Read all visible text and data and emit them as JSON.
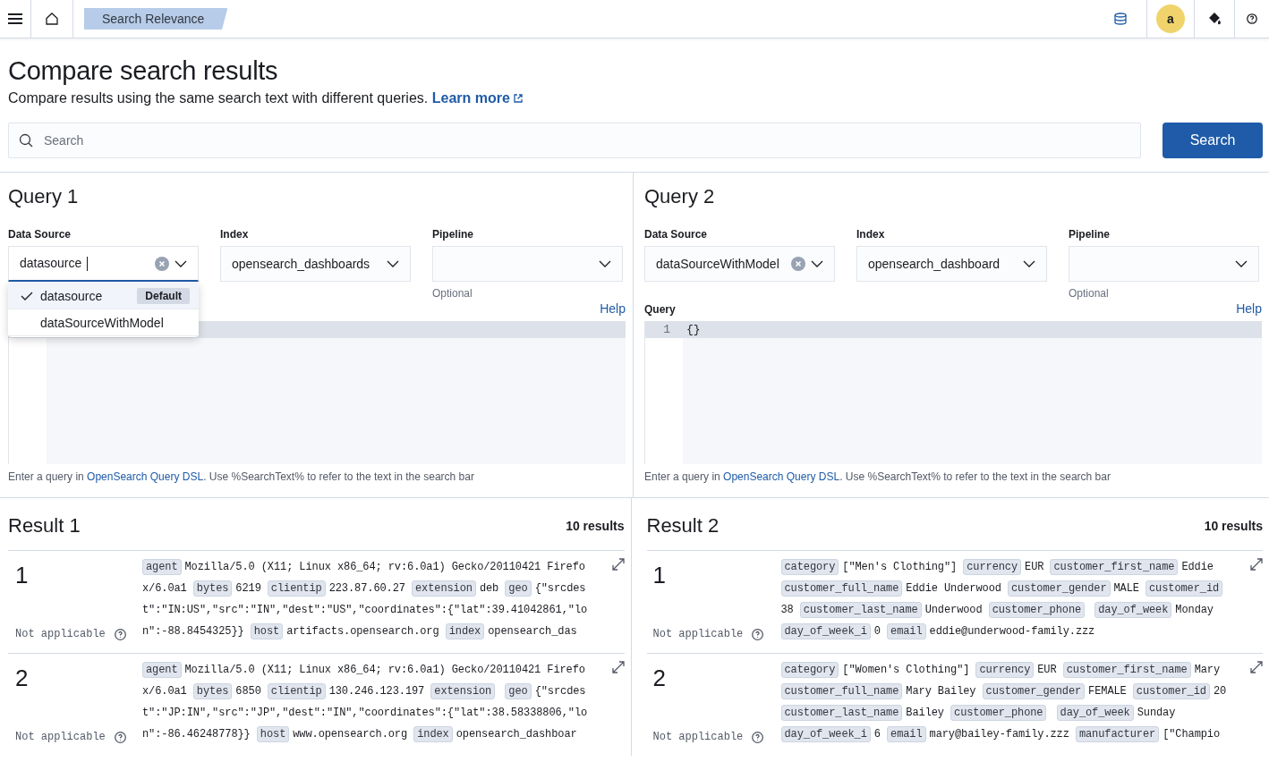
{
  "header": {
    "breadcrumb": "Search Relevance",
    "avatar": "a"
  },
  "page": {
    "title": "Compare search results",
    "description": "Compare results using the same search text with different queries. ",
    "learn_more": "Learn more"
  },
  "search": {
    "placeholder": "Search",
    "button": "Search"
  },
  "queries": [
    {
      "title": "Query 1",
      "data_source": {
        "label": "Data Source",
        "value": "datasource",
        "focused": true
      },
      "index": {
        "label": "Index",
        "value": "opensearch_dashboards"
      },
      "pipeline": {
        "label": "Pipeline",
        "hint": "Optional"
      },
      "help": "Help",
      "dropdown": {
        "options": [
          {
            "label": "datasource",
            "selected": true,
            "badge": "Default"
          },
          {
            "label": "dataSourceWithModel",
            "selected": false
          }
        ]
      },
      "hint": {
        "before": "Enter a query in ",
        "link": "OpenSearch Query DSL",
        "after": ". Use %SearchText% to refer to the text in the search bar"
      }
    },
    {
      "title": "Query 2",
      "data_source": {
        "label": "Data Source",
        "value": "dataSourceWithModel",
        "focused": false
      },
      "index": {
        "label": "Index",
        "value": "opensearch_dashboard"
      },
      "pipeline": {
        "label": "Pipeline",
        "hint": "Optional"
      },
      "query_label": "Query",
      "help": "Help",
      "lines": [
        {
          "number": "1",
          "text": "{}"
        }
      ],
      "hint": {
        "before": "Enter a query in ",
        "link": "OpenSearch Query DSL",
        "after": ". Use %SearchText% to refer to the text in the search bar"
      }
    }
  ],
  "results": [
    {
      "title": "Result 1",
      "count": "10 results",
      "rows": [
        {
          "rank": "1",
          "score": "Not applicable",
          "fields": [
            {
              "key": "agent",
              "value": "Mozilla/5.0 (X11; Linux x86_64; rv:6.0a1) Gecko/20110421 Firefox/6.0a1"
            },
            {
              "key": "bytes",
              "value": "6219"
            },
            {
              "key": "clientip",
              "value": "223.87.60.27"
            },
            {
              "key": "extension",
              "value": "deb"
            },
            {
              "key": "geo",
              "value": "{\"srcdest\":\"IN:US\",\"src\":\"IN\",\"dest\":\"US\",\"coordinates\":{\"lat\":39.41042861,\"lon\":-88.8454325}}"
            },
            {
              "key": "host",
              "value": "artifacts.opensearch.org"
            },
            {
              "key": "index",
              "value": "opensearch_das"
            }
          ]
        },
        {
          "rank": "2",
          "score": "Not applicable",
          "fields": [
            {
              "key": "agent",
              "value": "Mozilla/5.0 (X11; Linux x86_64; rv:6.0a1) Gecko/20110421 Firefox/6.0a1"
            },
            {
              "key": "bytes",
              "value": "6850"
            },
            {
              "key": "clientip",
              "value": "130.246.123.197"
            },
            {
              "key": "extension"
            },
            {
              "key": "geo",
              "value": "{\"srcdest\":\"JP:IN\",\"src\":\"JP\",\"dest\":\"IN\",\"coordinates\":{\"lat\":38.58338806,\"lon\":-86.46248778}}"
            },
            {
              "key": "host",
              "value": "www.opensearch.org"
            },
            {
              "key": "index",
              "value": "opensearch_dashboar"
            }
          ]
        }
      ]
    },
    {
      "title": "Result 2",
      "count": "10 results",
      "rows": [
        {
          "rank": "1",
          "score": "Not applicable",
          "fields": [
            {
              "key": "category",
              "value": "[\"Men's Clothing\"]"
            },
            {
              "key": "currency",
              "value": "EUR"
            },
            {
              "key": "customer_first_name",
              "value": "Eddie"
            },
            {
              "key": "customer_full_name",
              "value": "Eddie Underwood"
            },
            {
              "key": "customer_gender",
              "value": "MALE"
            },
            {
              "key": "customer_id",
              "value": "38"
            },
            {
              "key": "customer_last_name",
              "value": "Underwood"
            },
            {
              "key": "customer_phone"
            },
            {
              "key": "day_of_week",
              "value": "Monday"
            },
            {
              "key": "day_of_week_i",
              "value": "0"
            },
            {
              "key": "email",
              "value": "eddie@underwood-family.zzz"
            }
          ]
        },
        {
          "rank": "2",
          "score": "Not applicable",
          "fields": [
            {
              "key": "category",
              "value": "[\"Women's Clothing\"]"
            },
            {
              "key": "currency",
              "value": "EUR"
            },
            {
              "key": "customer_first_name",
              "value": "Mary"
            },
            {
              "key": "customer_full_name",
              "value": "Mary Bailey"
            },
            {
              "key": "customer_gender",
              "value": "FEMALE"
            },
            {
              "key": "customer_id",
              "value": "20"
            },
            {
              "key": "customer_last_name",
              "value": "Bailey"
            },
            {
              "key": "customer_phone"
            },
            {
              "key": "day_of_week",
              "value": "Sunday"
            },
            {
              "key": "day_of_week_i",
              "value": "6"
            },
            {
              "key": "email",
              "value": "mary@bailey-family.zzz"
            },
            {
              "key": "manufacturer",
              "value": "[\"Champio"
            }
          ]
        }
      ]
    }
  ]
}
